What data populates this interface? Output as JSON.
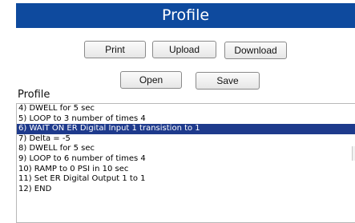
{
  "title": "Profile",
  "buttons": {
    "print": "Print",
    "upload": "Upload",
    "download": "Download",
    "open": "Open",
    "save": "Save"
  },
  "list_label": "Profile",
  "colors": {
    "title_bar": "#0e4a9e",
    "selection": "#1e3a8c"
  },
  "steps": [
    "4) DWELL for 5 sec",
    "5) LOOP to 3 number of times 4",
    "6) WAIT ON ER Digital Input 1 transistion to 1",
    "7) Delta = -5",
    "8) DWELL for 5 sec",
    "9) LOOP to 6 number of times 4",
    "10) RAMP to 0 PSI in 10 sec",
    "11) Set ER Digital Output 1 to 1",
    "12) END"
  ],
  "selected_step_index": 2
}
